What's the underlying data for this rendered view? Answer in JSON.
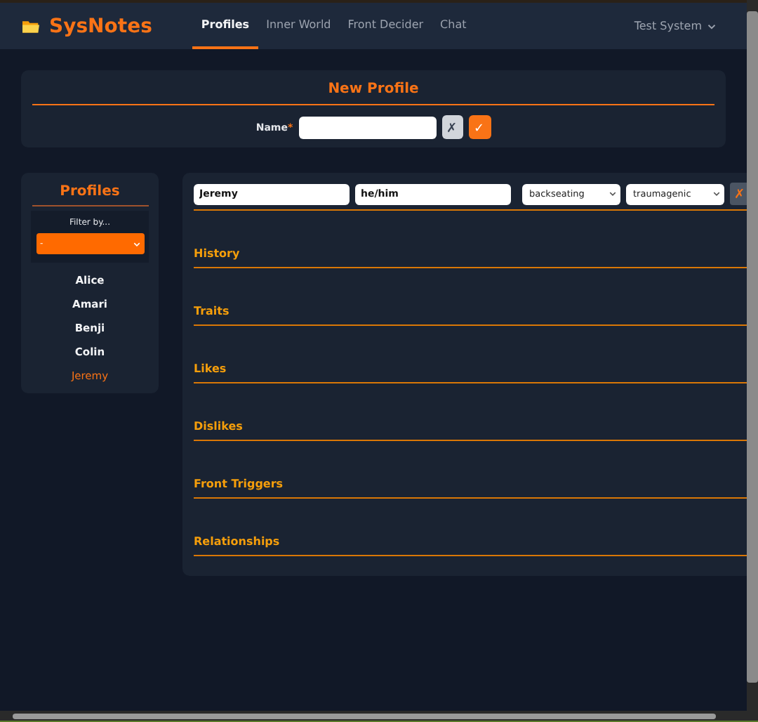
{
  "nav": {
    "brand": "SysNotes",
    "links": [
      {
        "label": "Profiles",
        "selected": true
      },
      {
        "label": "Inner World",
        "selected": false
      },
      {
        "label": "Front Decider",
        "selected": false
      },
      {
        "label": "Chat",
        "selected": false
      }
    ],
    "system": "Test System"
  },
  "new_profile": {
    "title": "New Profile",
    "name_label": "Name",
    "required_mark": "*",
    "cancel": "✗",
    "confirm": "✓"
  },
  "profiles": {
    "title": "Profiles",
    "filter_label": "Filter by...",
    "filter_value": "-",
    "items": [
      {
        "name": "Alice",
        "selected": false
      },
      {
        "name": "Amari",
        "selected": false
      },
      {
        "name": "Benji",
        "selected": false
      },
      {
        "name": "Colin",
        "selected": false
      },
      {
        "name": "Jeremy",
        "selected": true
      }
    ]
  },
  "editor": {
    "name": "Jeremy",
    "pronouns": "he/him",
    "status": "backseating",
    "origin": "traumagenic",
    "delete": "✗",
    "sections": [
      "History",
      "Traits",
      "Likes",
      "Dislikes",
      "Front Triggers",
      "Relationships"
    ]
  }
}
